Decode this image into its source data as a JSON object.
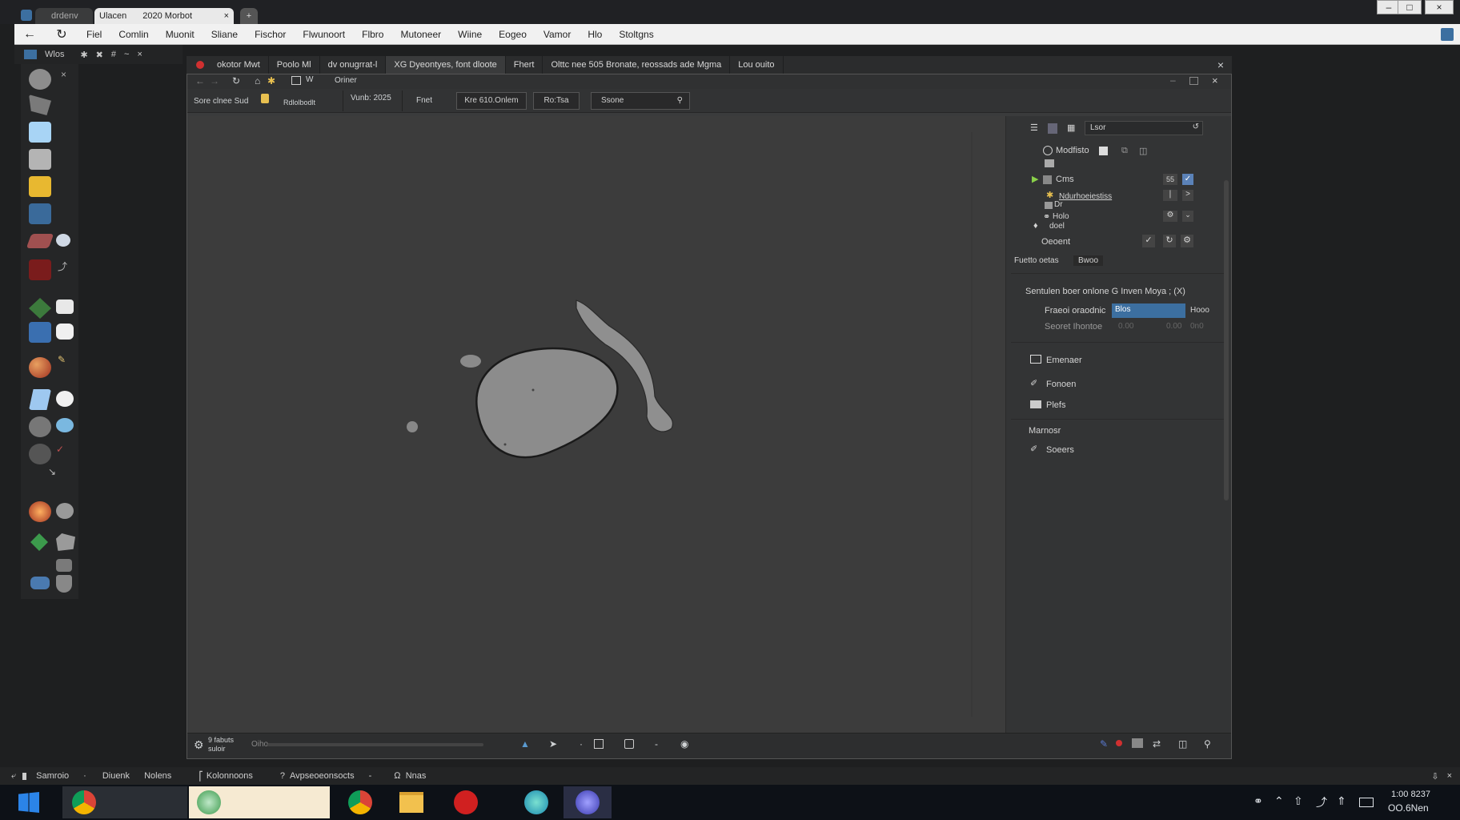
{
  "browser": {
    "tabs": [
      {
        "label": "drdenv"
      },
      {
        "label": "Ulacen"
      },
      {
        "label": "2020 Morbot"
      }
    ],
    "close_glyph": "×",
    "newtab_glyph": "+",
    "window_controls": [
      "–",
      "□",
      "×"
    ]
  },
  "menu": {
    "items": [
      "Fiel",
      "Comlin",
      "Muonit",
      "Sliane",
      "Fischor",
      "Flwunoort",
      "Flbro",
      "Mutoneer",
      "Wiine",
      "Eogeo",
      "Vamor",
      "Hlo",
      "Stoltgns"
    ]
  },
  "toolbox": {
    "title": "Wlos",
    "close": "×"
  },
  "doc_tabs": [
    {
      "label": "okotor Mwt"
    },
    {
      "label": "Poolo Ml"
    },
    {
      "label": "dv onugrrat-l"
    },
    {
      "label": "XG Dyeontyes, font dloote"
    },
    {
      "label": "Fhert"
    },
    {
      "label": "Olttc nee 505 Bronate, reossads ade Mgma"
    },
    {
      "label": "Lou ouito"
    }
  ],
  "maya": {
    "nav_label": "Oriner",
    "shelf": {
      "workspace": "Sore clnee Sud",
      "lock_label": "Rdlolbodlt",
      "version": "Vunb: 2025",
      "fnet": "Fnet",
      "button1": "Kre 610.Onlem",
      "button2": "Ro:Tsa",
      "search_placeholder": "Ssone"
    },
    "outliner": {
      "search_value": "Lsor",
      "header_item": "Modfisto",
      "rows": [
        {
          "label": "Cms",
          "badge": "55"
        },
        {
          "label": "Ndurhoeiestiss"
        },
        {
          "label": "Dr"
        },
        {
          "label": "Holo"
        },
        {
          "label": "doel"
        }
      ],
      "current_label": "Oeoent",
      "attr_tab_label": "Fuetto oetas",
      "attr_tab_value": "Bwoo",
      "section_title": "Sentulen  boer onlone  G Inven  Moya  ; (X)",
      "field1_label": "Fraeoi oraodnic",
      "field1_value": "Blos",
      "field1_extra": "Hooo",
      "field2_label": "Seoret Ihontoe",
      "field2_value": "0.00",
      "field2_extra": "0.00",
      "field2_extra2": "0n0",
      "list": [
        {
          "label": "Emenaer"
        },
        {
          "label": "Fonoen"
        },
        {
          "label": "Plefs"
        }
      ],
      "group_label": "Marnosr",
      "group_item": "Soeers"
    },
    "status": {
      "left_line1": "9 fabuts",
      "left_line2": "suloir",
      "mid_label": "Oiho"
    }
  },
  "bottombar": {
    "items": [
      {
        "label": "Samroio"
      },
      {
        "label": "Diuenk"
      },
      {
        "label": "Nolens"
      },
      {
        "label": "Kolonnoons"
      },
      {
        "label": "Avpseoeonsocts"
      },
      {
        "label": "Nnas"
      }
    ]
  },
  "taskbar": {
    "clock_time": "1:00 8237",
    "clock_date": "OO.6Nen"
  },
  "colors": {
    "accent": "#3c6fa0",
    "viewport": "#3c3c3c",
    "mesh": "#8c8c8c"
  }
}
